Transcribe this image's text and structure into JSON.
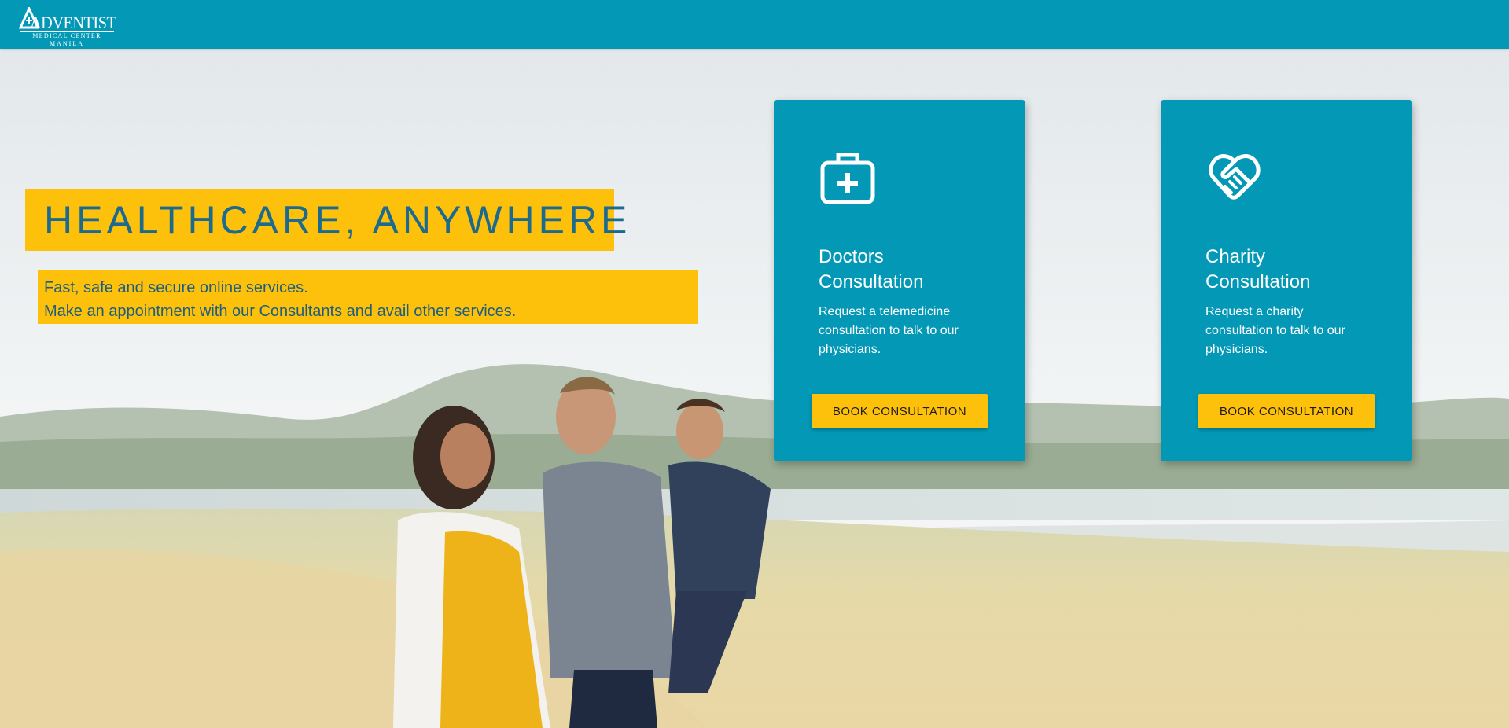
{
  "header": {
    "logo": {
      "word": "ADVENTIST",
      "line1": "MEDICAL CENTER",
      "line2": "MANILA",
      "icon": "adventist-logo-icon"
    }
  },
  "hero": {
    "headline": "HEALTHCARE, ANYWHERE",
    "subtext": [
      "Fast, safe and secure online services.",
      "Make an appointment with our Consultants and avail other services."
    ],
    "background": "family-photo-field-lake"
  },
  "cards": [
    {
      "icon": "medical-kit-icon",
      "title_line1": "Doctors",
      "title_line2": "Consultation",
      "description": "Request a telemedicine consultation to talk to our physicians.",
      "button_label": "BOOK CONSULTATION"
    },
    {
      "icon": "handshake-icon",
      "title_line1": "Charity",
      "title_line2": "Consultation",
      "description": "Request a charity consultation to talk to our physicians.",
      "button_label": "BOOK CONSULTATION"
    }
  ],
  "colors": {
    "primary": "#0298b6",
    "accent": "#fdc10c",
    "headline_text": "#1d6a8f"
  }
}
